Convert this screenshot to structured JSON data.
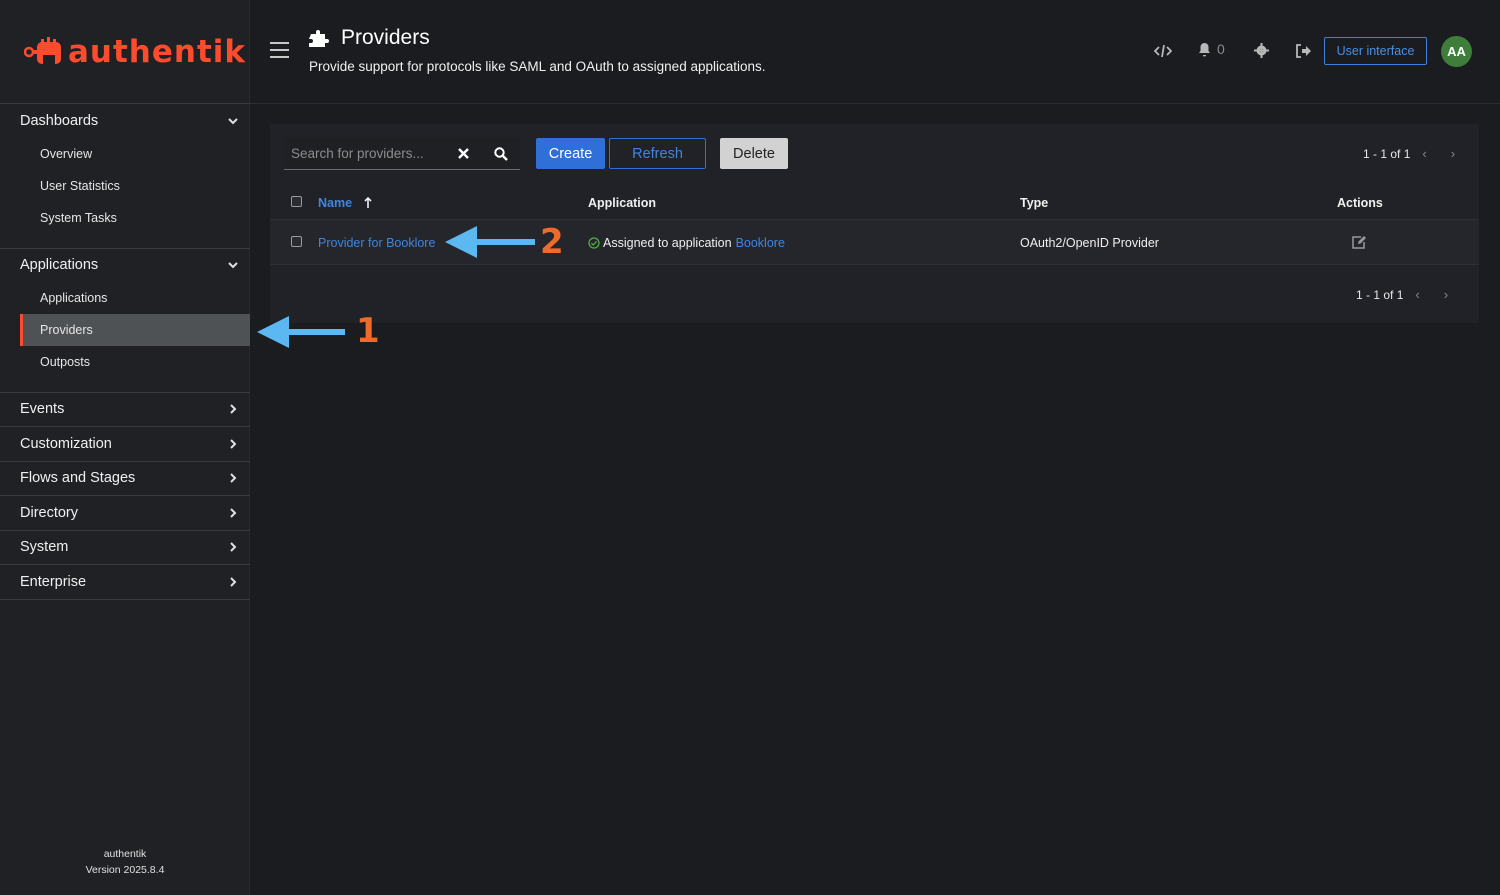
{
  "brand": {
    "name": "authentik",
    "color": "#fd4b2d"
  },
  "sidebar": {
    "sections": [
      {
        "label": "Dashboards",
        "expanded": true,
        "items": [
          "Overview",
          "User Statistics",
          "System Tasks"
        ]
      },
      {
        "label": "Applications",
        "expanded": true,
        "items": [
          "Applications",
          "Providers",
          "Outposts"
        ]
      },
      {
        "label": "Events",
        "expanded": false
      },
      {
        "label": "Customization",
        "expanded": false
      },
      {
        "label": "Flows and Stages",
        "expanded": false
      },
      {
        "label": "Directory",
        "expanded": false
      },
      {
        "label": "System",
        "expanded": false
      },
      {
        "label": "Enterprise",
        "expanded": false
      }
    ],
    "active_item": "Providers",
    "footer_name": "authentik",
    "footer_version": "Version 2025.8.4"
  },
  "header": {
    "title": "Providers",
    "subtitle": "Provide support for protocols like SAML and OAuth to assigned applications.",
    "notification_count": "0",
    "user_interface_label": "User interface",
    "avatar_initials": "AA"
  },
  "toolbar": {
    "search_placeholder": "Search for providers...",
    "create_label": "Create",
    "refresh_label": "Refresh",
    "delete_label": "Delete",
    "pagination": "1 - 1 of 1"
  },
  "table": {
    "columns": [
      "Name",
      "Application",
      "Type",
      "Actions"
    ],
    "rows": [
      {
        "name": "Provider for Booklore",
        "application_prefix": "Assigned to application",
        "application_link": "Booklore",
        "type": "OAuth2/OpenID Provider"
      }
    ],
    "footer_pagination": "1 - 1 of 1"
  },
  "annotations": [
    {
      "number": "1",
      "color": "#5bb8f0"
    },
    {
      "number": "2",
      "color": "#5bb8f0"
    }
  ]
}
